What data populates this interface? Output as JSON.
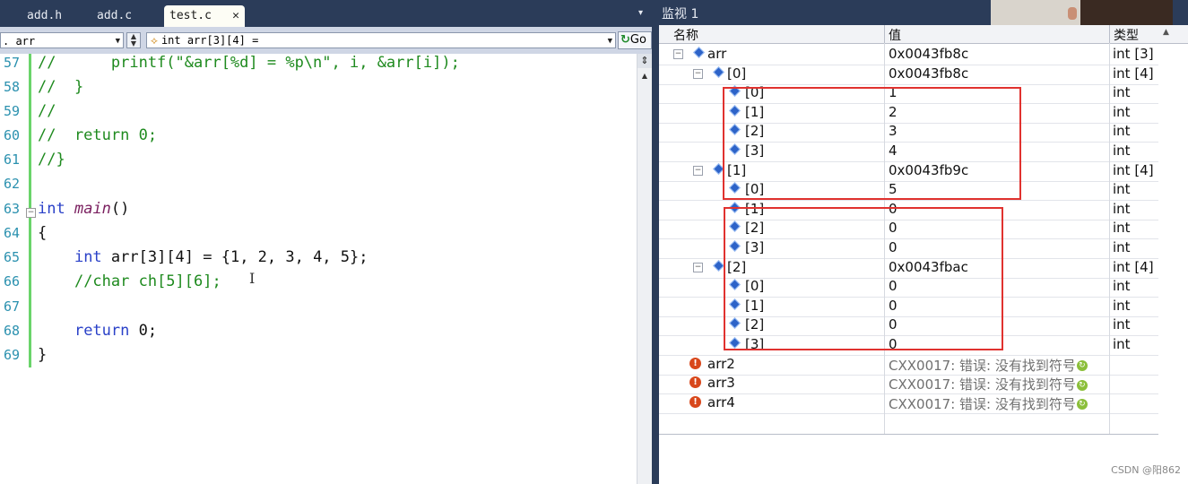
{
  "editor": {
    "tabs": [
      {
        "label": "add.h",
        "active": false
      },
      {
        "label": "add.c",
        "active": false
      },
      {
        "label": "test.c",
        "active": true
      }
    ],
    "tab_close_glyph": "✕",
    "tab_dropdown_glyph": "▾",
    "scope_combo": ". arr",
    "member_combo": "int arr[3][4] =",
    "go_label": "Go",
    "line_numbers": [
      "57",
      "58",
      "59",
      "60",
      "61",
      "62",
      "63",
      "64",
      "65",
      "66",
      "67",
      "68",
      "69"
    ],
    "text_cursor": "I"
  },
  "watch": {
    "title": "监视 1",
    "headers": {
      "name": "名称",
      "value": "值",
      "type": "类型"
    },
    "rows": [
      {
        "name": "arr",
        "value": "0x0043fb8c",
        "type": "int [3]"
      },
      {
        "name": "[0]",
        "value": "0x0043fb8c",
        "type": "int [4]"
      },
      {
        "name": "[0]",
        "value": "1",
        "type": "int"
      },
      {
        "name": "[1]",
        "value": "2",
        "type": "int"
      },
      {
        "name": "[2]",
        "value": "3",
        "type": "int"
      },
      {
        "name": "[3]",
        "value": "4",
        "type": "int"
      },
      {
        "name": "[1]",
        "value": "0x0043fb9c",
        "type": "int [4]"
      },
      {
        "name": "[0]",
        "value": "5",
        "type": "int"
      },
      {
        "name": "[1]",
        "value": "0",
        "type": "int"
      },
      {
        "name": "[2]",
        "value": "0",
        "type": "int"
      },
      {
        "name": "[3]",
        "value": "0",
        "type": "int"
      },
      {
        "name": "[2]",
        "value": "0x0043fbac",
        "type": "int [4]"
      },
      {
        "name": "[0]",
        "value": "0",
        "type": "int"
      },
      {
        "name": "[1]",
        "value": "0",
        "type": "int"
      },
      {
        "name": "[2]",
        "value": "0",
        "type": "int"
      },
      {
        "name": "[3]",
        "value": "0",
        "type": "int"
      },
      {
        "name": "arr2",
        "value": "CXX0017: 错误: 没有找到符号",
        "type": ""
      },
      {
        "name": "arr3",
        "value": "CXX0017: 错误: 没有找到符号",
        "type": ""
      },
      {
        "name": "arr4",
        "value": "CXX0017: 错误: 没有找到符号",
        "type": ""
      }
    ],
    "colors": {
      "highlight_box": "#e0322f",
      "title_bar": "#2b3c59"
    }
  },
  "credit": "CSDN @阳862"
}
